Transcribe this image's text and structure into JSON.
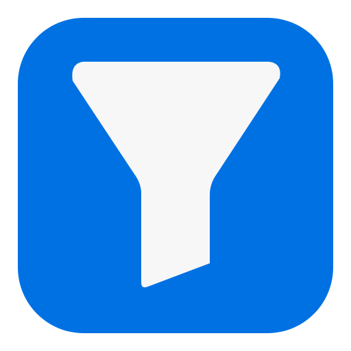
{
  "icon": {
    "name": "filter-funnel-icon",
    "background_color": "#0071E3",
    "glyph_color": "#F7F7F7"
  }
}
